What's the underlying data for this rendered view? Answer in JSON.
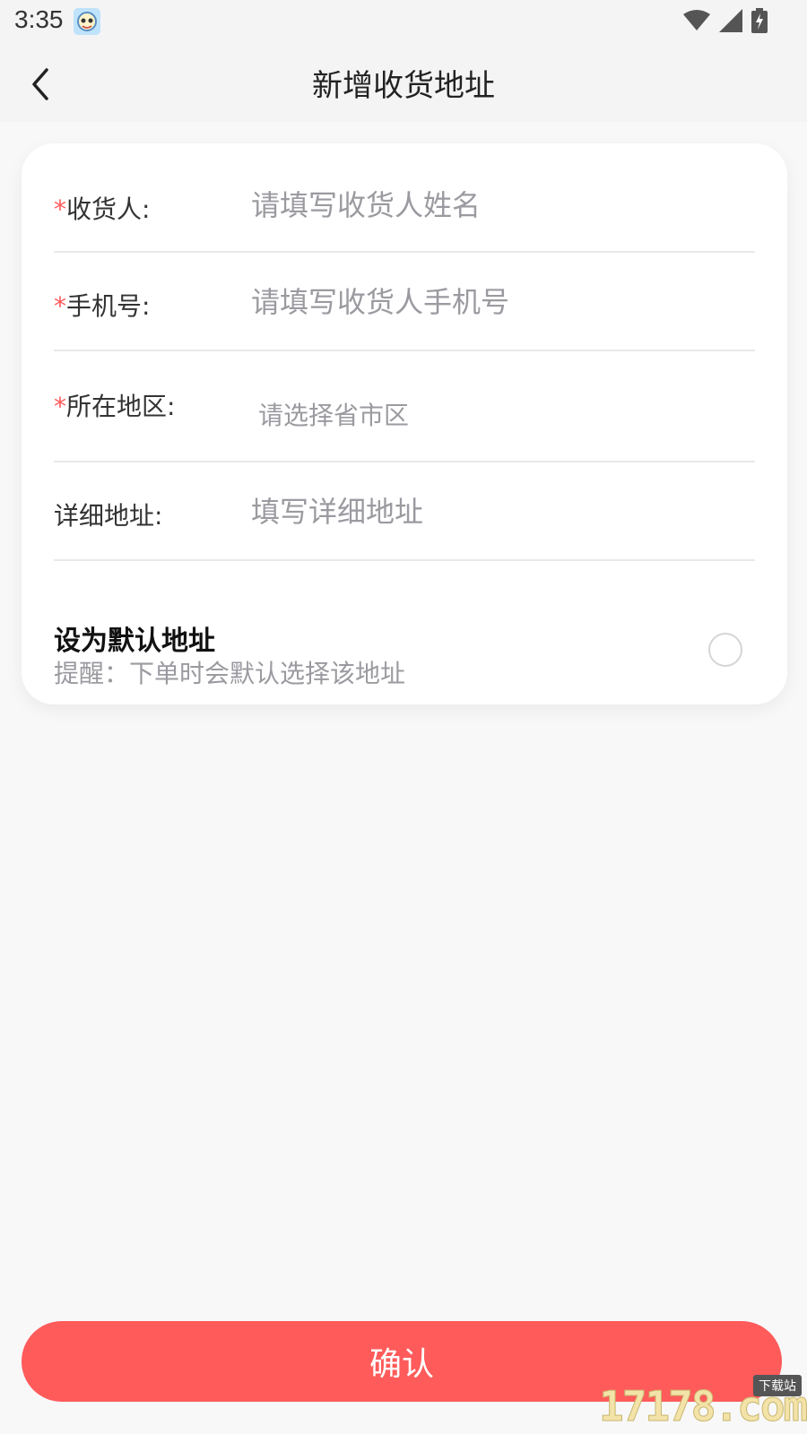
{
  "status_bar": {
    "time": "3:35"
  },
  "header": {
    "title": "新增收货地址"
  },
  "form": {
    "required_mark": "*",
    "fields": [
      {
        "label": "收货人:",
        "placeholder": "请填写收货人姓名",
        "value": ""
      },
      {
        "label": "手机号:",
        "placeholder": "请填写收货人手机号",
        "value": ""
      },
      {
        "label": "所在地区:",
        "placeholder": "请选择省市区"
      },
      {
        "label": "详细地址:",
        "placeholder": "填写详细地址",
        "value": ""
      }
    ]
  },
  "default_address": {
    "title": "设为默认地址",
    "hint": "提醒：下单时会默认选择该地址",
    "checked": false
  },
  "confirm_label": "确认",
  "watermark": {
    "logo": "17178.com",
    "tag": "下载站"
  },
  "colors": {
    "accent": "#ff5b5b",
    "required": "#ff5a5a",
    "background": "#f8f8f9"
  }
}
